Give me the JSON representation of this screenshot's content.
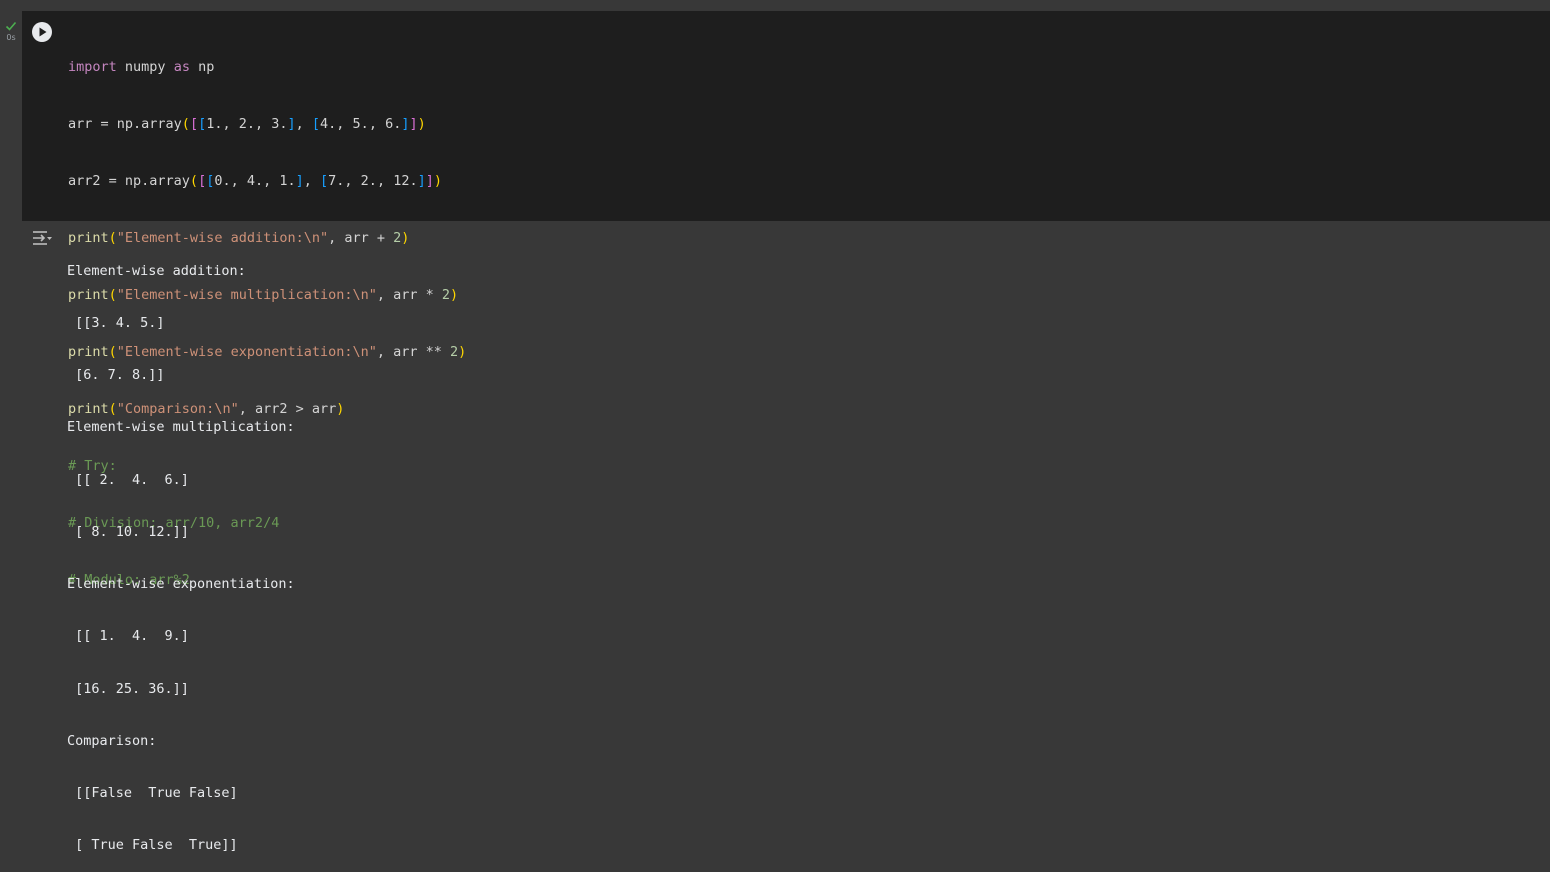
{
  "cell": {
    "exec_time": "0s",
    "code": {
      "line1": {
        "kw1": "import",
        "mid": " numpy ",
        "kw2": "as",
        "end": " np"
      },
      "line2": {
        "pre": "arr = np.array",
        "b_open": "(",
        "s_open": "[",
        "r1_open": "[",
        "r1_vals": "1., 2., 3.",
        "r1_close": "]",
        "sep": ", ",
        "r2_open": "[",
        "r2_vals": "4., 5., 6.",
        "r2_close": "]",
        "s_close": "]",
        "b_close": ")"
      },
      "line3": {
        "pre": "arr2 = np.array",
        "b_open": "(",
        "s_open": "[",
        "r1_open": "[",
        "r1_vals": "0., 4., 1.",
        "r1_close": "]",
        "sep": ", ",
        "r2_open": "[",
        "r2_vals": "7., 2., 12.",
        "r2_close": "]",
        "s_close": "]",
        "b_close": ")"
      },
      "line4": {
        "fn": "print",
        "open": "(",
        "str": "\"Element-wise addition:\\n\"",
        "rest": ", arr + ",
        "num": "2",
        "close": ")"
      },
      "line5": {
        "fn": "print",
        "open": "(",
        "str": "\"Element-wise multiplication:\\n\"",
        "rest": ", arr * ",
        "num": "2",
        "close": ")"
      },
      "line6": {
        "fn": "print",
        "open": "(",
        "str": "\"Element-wise exponentiation:\\n\"",
        "rest": ", arr ** ",
        "num": "2",
        "close": ")"
      },
      "line7": {
        "fn": "print",
        "open": "(",
        "str": "\"Comparison:\\n\"",
        "rest": ", arr2 > arr",
        "close": ")"
      },
      "line8": "# Try:",
      "line9": "# Division: arr/10, arr2/4",
      "line10": "# Modulo: arr%2"
    }
  },
  "output": {
    "lines": [
      "Element-wise addition:",
      " [[3. 4. 5.]",
      " [6. 7. 8.]]",
      "Element-wise multiplication:",
      " [[ 2.  4.  6.]",
      " [ 8. 10. 12.]]",
      "Element-wise exponentiation:",
      " [[ 1.  4.  9.]",
      " [16. 25. 36.]]",
      "Comparison:",
      " [[False  True False]",
      " [ True False  True]]"
    ]
  },
  "colors": {
    "cell_bg": "#1e1e1e",
    "page_bg": "#383838",
    "keyword": "#c586c0",
    "string": "#ce9178",
    "number": "#b5cea8",
    "comment": "#6a9955",
    "function": "#dcdcaa",
    "success_check": "#4caf50"
  },
  "icons": {
    "status": "check-icon",
    "run": "play-icon",
    "output_menu": "output-actions-icon"
  }
}
